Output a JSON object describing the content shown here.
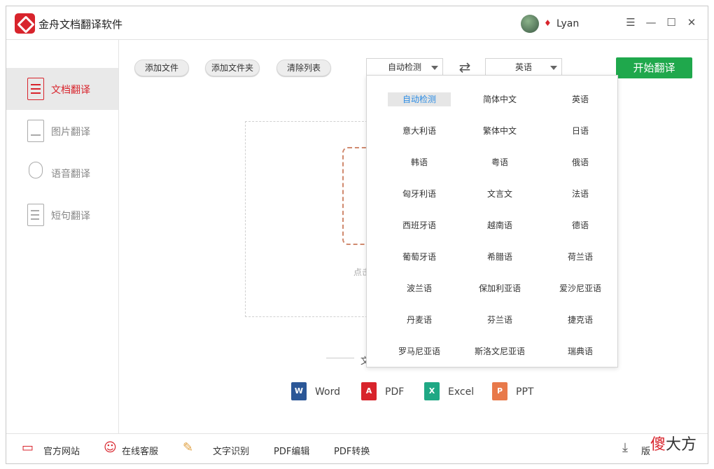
{
  "window": {
    "title": "金舟文档翻译软件",
    "user": "Lyan",
    "controls": [
      "☰",
      "—",
      "☐",
      "✕"
    ]
  },
  "sidebar": {
    "items": [
      {
        "label": "文档翻译",
        "active": true
      },
      {
        "label": "图片翻译",
        "active": false
      },
      {
        "label": "语音翻译",
        "active": false
      },
      {
        "label": "短句翻译",
        "active": false
      }
    ]
  },
  "toolbar": {
    "add_file": "添加文件",
    "add_folder": "添加文件夹",
    "clear_list": "清除列表",
    "source_lang": "自动检测",
    "target_lang": "英语",
    "start_button": "开始翻译"
  },
  "drop_area": {
    "hint_fragment": "点击",
    "separator_fragment": "文"
  },
  "formats": [
    {
      "label": "Word",
      "icon": "word-icon",
      "color": "#2b5797",
      "glyph": "W"
    },
    {
      "label": "PDF",
      "icon": "pdf-icon",
      "color": "#d8242c",
      "glyph": "A"
    },
    {
      "label": "Excel",
      "icon": "excel-icon",
      "color": "#1fa884",
      "glyph": "X"
    },
    {
      "label": "PPT",
      "icon": "ppt-icon",
      "color": "#e8794a",
      "glyph": "P"
    }
  ],
  "language_dropdown": {
    "selected": "自动检测",
    "options": [
      "自动检测",
      "简体中文",
      "英语",
      "意大利语",
      "繁体中文",
      "日语",
      "韩语",
      "粤语",
      "俄语",
      "匈牙利语",
      "文言文",
      "法语",
      "西班牙语",
      "越南语",
      "德语",
      "葡萄牙语",
      "希腊语",
      "荷兰语",
      "波兰语",
      "保加利亚语",
      "爱沙尼亚语",
      "丹麦语",
      "芬兰语",
      "捷克语",
      "罗马尼亚语",
      "斯洛文尼亚语",
      "瑞典语"
    ]
  },
  "bottombar": {
    "website": "官方网站",
    "support": "在线客服",
    "ocr": "文字识别",
    "pdf_edit": "PDF编辑",
    "pdf_convert": "PDF转换",
    "version_fragment": "版"
  },
  "watermark": {
    "red_char": "傻",
    "text": "大方"
  }
}
